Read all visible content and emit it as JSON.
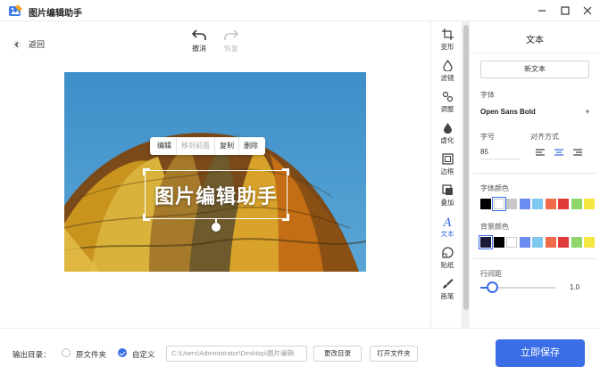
{
  "app": {
    "title": "图片编辑助手"
  },
  "header": {
    "back_label": "返回",
    "undo_label": "撤消",
    "redo_label": "恢复"
  },
  "canvas": {
    "overlay_text": "图片编辑助手",
    "context_menu": [
      "编辑",
      "移到前面",
      "复制",
      "删除"
    ]
  },
  "tools": [
    {
      "label": "变形",
      "icon": "crop-icon"
    },
    {
      "label": "滤镜",
      "icon": "drop-icon"
    },
    {
      "label": "调整",
      "icon": "adjust-icon"
    },
    {
      "label": "虚化",
      "icon": "blur-icon"
    },
    {
      "label": "边框",
      "icon": "frame-icon"
    },
    {
      "label": "叠加",
      "icon": "overlay-icon"
    },
    {
      "label": "文本",
      "icon": "text-icon"
    },
    {
      "label": "贴纸",
      "icon": "sticker-icon"
    },
    {
      "label": "画笔",
      "icon": "brush-icon"
    }
  ],
  "panel": {
    "title": "文本",
    "new_text": "新文本",
    "font_label": "字体",
    "font_value": "Open Sans Bold",
    "size_label": "字号",
    "size_value": "85",
    "align_label": "对齐方式",
    "font_color_label": "字体颜色",
    "bg_color_label": "背景颜色",
    "line_spacing_label": "行间距",
    "line_spacing_value": "1.0",
    "line_spacing_fraction": 0.16
  },
  "colors": {
    "accent": "#3b6de6",
    "font_palette": [
      "#000000",
      "#ffffff",
      "#c8c8c8",
      "#6b8cf0",
      "#7ec8ef",
      "#f06b4a",
      "#e03a3a",
      "#8fd66b",
      "#f5e642"
    ],
    "bg_palette": [
      "#1a1a3a",
      "#000000",
      "#ffffff",
      "#6b8cf0",
      "#7ec8ef",
      "#f06b4a",
      "#e03a3a",
      "#8fd66b",
      "#f5e642"
    ]
  },
  "footer": {
    "output_label": "输出目录：",
    "option_original": "原文件夹",
    "option_custom": "自定义",
    "path": "C:\\Users\\Administrator\\Desktop\\图片编辑",
    "change_dir": "更改目录",
    "open_folder": "打开文件夹",
    "save": "立即保存"
  }
}
